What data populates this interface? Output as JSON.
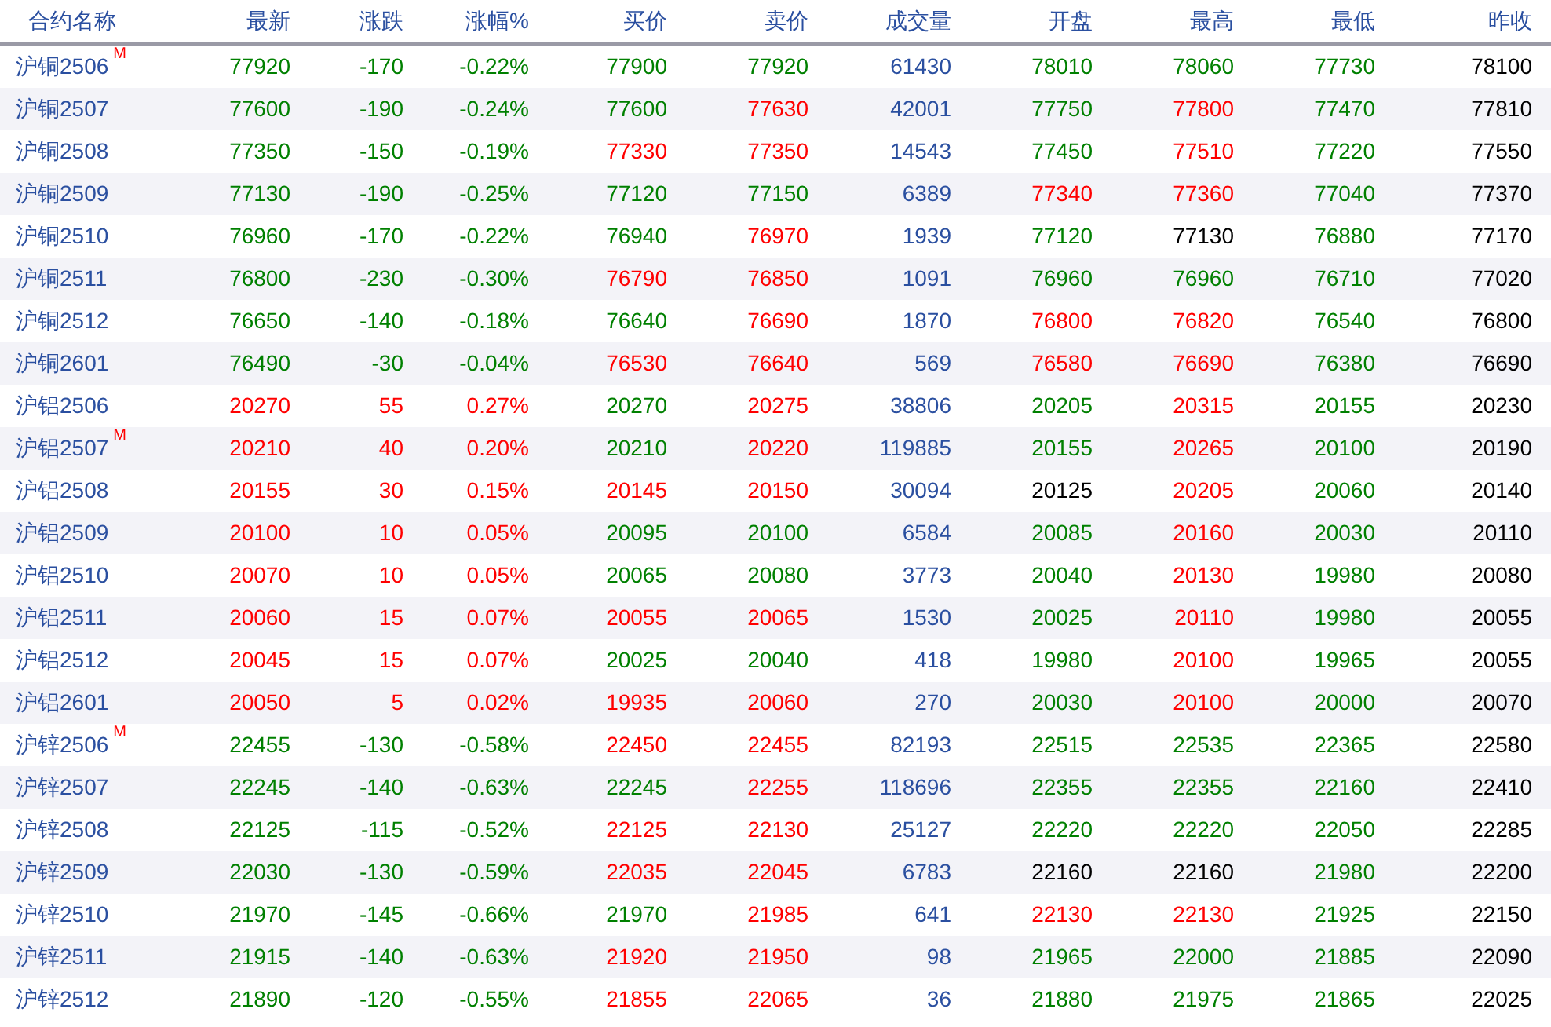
{
  "columns": [
    "合约名称",
    "最新",
    "涨跌",
    "涨幅%",
    "买价",
    "卖价",
    "成交量",
    "开盘",
    "最高",
    "最低",
    "昨收"
  ],
  "rows": [
    {
      "name": "沪铜2506",
      "badge": "M",
      "volume": "61430",
      "cells": [
        {
          "text": "77920",
          "rising": false,
          "falling": true
        },
        {
          "text": "-170",
          "rising": false,
          "falling": true
        },
        {
          "text": "-0.22%",
          "rising": false,
          "falling": true
        },
        {
          "text": "77900",
          "rising": false,
          "falling": true
        },
        {
          "text": "77920",
          "rising": false,
          "falling": true
        },
        {
          "text": "78010",
          "rising": false,
          "falling": true
        },
        {
          "text": "78060",
          "rising": false,
          "falling": true
        },
        {
          "text": "77730",
          "rising": false,
          "falling": true
        },
        {
          "text": "78100",
          "rising": false,
          "falling": false
        }
      ]
    },
    {
      "name": "沪铜2507",
      "volume": "42001",
      "cells": [
        {
          "text": "77600",
          "rising": false,
          "falling": true
        },
        {
          "text": "-190",
          "rising": false,
          "falling": true
        },
        {
          "text": "-0.24%",
          "rising": false,
          "falling": true
        },
        {
          "text": "77600",
          "rising": false,
          "falling": true
        },
        {
          "text": "77630",
          "rising": true,
          "falling": false
        },
        {
          "text": "77750",
          "rising": false,
          "falling": true
        },
        {
          "text": "77800",
          "rising": true,
          "falling": false
        },
        {
          "text": "77470",
          "rising": false,
          "falling": true
        },
        {
          "text": "77810",
          "rising": false,
          "falling": false
        }
      ]
    },
    {
      "name": "沪铜2508",
      "volume": "14543",
      "cells": [
        {
          "text": "77350",
          "rising": false,
          "falling": true
        },
        {
          "text": "-150",
          "rising": false,
          "falling": true
        },
        {
          "text": "-0.19%",
          "rising": false,
          "falling": true
        },
        {
          "text": "77330",
          "rising": true,
          "falling": false
        },
        {
          "text": "77350",
          "rising": true,
          "falling": false
        },
        {
          "text": "77450",
          "rising": false,
          "falling": true
        },
        {
          "text": "77510",
          "rising": true,
          "falling": false
        },
        {
          "text": "77220",
          "rising": false,
          "falling": true
        },
        {
          "text": "77550",
          "rising": false,
          "falling": false
        }
      ]
    },
    {
      "name": "沪铜2509",
      "volume": "6389",
      "cells": [
        {
          "text": "77130",
          "rising": false,
          "falling": true
        },
        {
          "text": "-190",
          "rising": false,
          "falling": true
        },
        {
          "text": "-0.25%",
          "rising": false,
          "falling": true
        },
        {
          "text": "77120",
          "rising": false,
          "falling": true
        },
        {
          "text": "77150",
          "rising": false,
          "falling": true
        },
        {
          "text": "77340",
          "rising": true,
          "falling": false
        },
        {
          "text": "77360",
          "rising": true,
          "falling": false
        },
        {
          "text": "77040",
          "rising": false,
          "falling": true
        },
        {
          "text": "77370",
          "rising": false,
          "falling": false
        }
      ]
    },
    {
      "name": "沪铜2510",
      "volume": "1939",
      "cells": [
        {
          "text": "76960",
          "rising": false,
          "falling": true
        },
        {
          "text": "-170",
          "rising": false,
          "falling": true
        },
        {
          "text": "-0.22%",
          "rising": false,
          "falling": true
        },
        {
          "text": "76940",
          "rising": false,
          "falling": true
        },
        {
          "text": "76970",
          "rising": true,
          "falling": false
        },
        {
          "text": "77120",
          "rising": false,
          "falling": true
        },
        {
          "text": "77130",
          "rising": false,
          "falling": false
        },
        {
          "text": "76880",
          "rising": false,
          "falling": true
        },
        {
          "text": "77170",
          "rising": false,
          "falling": false
        }
      ]
    },
    {
      "name": "沪铜2511",
      "volume": "1091",
      "cells": [
        {
          "text": "76800",
          "rising": false,
          "falling": true
        },
        {
          "text": "-230",
          "rising": false,
          "falling": true
        },
        {
          "text": "-0.30%",
          "rising": false,
          "falling": true
        },
        {
          "text": "76790",
          "rising": true,
          "falling": false
        },
        {
          "text": "76850",
          "rising": true,
          "falling": false
        },
        {
          "text": "76960",
          "rising": false,
          "falling": true
        },
        {
          "text": "76960",
          "rising": false,
          "falling": true
        },
        {
          "text": "76710",
          "rising": false,
          "falling": true
        },
        {
          "text": "77020",
          "rising": false,
          "falling": false
        }
      ]
    },
    {
      "name": "沪铜2512",
      "volume": "1870",
      "cells": [
        {
          "text": "76650",
          "rising": false,
          "falling": true
        },
        {
          "text": "-140",
          "rising": false,
          "falling": true
        },
        {
          "text": "-0.18%",
          "rising": false,
          "falling": true
        },
        {
          "text": "76640",
          "rising": false,
          "falling": true
        },
        {
          "text": "76690",
          "rising": true,
          "falling": false
        },
        {
          "text": "76800",
          "rising": true,
          "falling": false
        },
        {
          "text": "76820",
          "rising": true,
          "falling": false
        },
        {
          "text": "76540",
          "rising": false,
          "falling": true
        },
        {
          "text": "76800",
          "rising": false,
          "falling": false
        }
      ]
    },
    {
      "name": "沪铜2601",
      "volume": "569",
      "cells": [
        {
          "text": "76490",
          "rising": false,
          "falling": true
        },
        {
          "text": "-30",
          "rising": false,
          "falling": true
        },
        {
          "text": "-0.04%",
          "rising": false,
          "falling": true
        },
        {
          "text": "76530",
          "rising": true,
          "falling": false
        },
        {
          "text": "76640",
          "rising": true,
          "falling": false
        },
        {
          "text": "76580",
          "rising": true,
          "falling": false
        },
        {
          "text": "76690",
          "rising": true,
          "falling": false
        },
        {
          "text": "76380",
          "rising": false,
          "falling": true
        },
        {
          "text": "76690",
          "rising": false,
          "falling": false
        }
      ]
    },
    {
      "name": "沪铝2506",
      "volume": "38806",
      "cells": [
        {
          "text": "20270",
          "rising": true,
          "falling": false
        },
        {
          "text": "55",
          "rising": true,
          "falling": false
        },
        {
          "text": "0.27%",
          "rising": true,
          "falling": false
        },
        {
          "text": "20270",
          "rising": false,
          "falling": true
        },
        {
          "text": "20275",
          "rising": true,
          "falling": false
        },
        {
          "text": "20205",
          "rising": false,
          "falling": true
        },
        {
          "text": "20315",
          "rising": true,
          "falling": false
        },
        {
          "text": "20155",
          "rising": false,
          "falling": true
        },
        {
          "text": "20230",
          "rising": false,
          "falling": false
        }
      ]
    },
    {
      "name": "沪铝2507",
      "badge": "M",
      "volume": "119885",
      "cells": [
        {
          "text": "20210",
          "rising": true,
          "falling": false
        },
        {
          "text": "40",
          "rising": true,
          "falling": false
        },
        {
          "text": "0.20%",
          "rising": true,
          "falling": false
        },
        {
          "text": "20210",
          "rising": false,
          "falling": true
        },
        {
          "text": "20220",
          "rising": true,
          "falling": false
        },
        {
          "text": "20155",
          "rising": false,
          "falling": true
        },
        {
          "text": "20265",
          "rising": true,
          "falling": false
        },
        {
          "text": "20100",
          "rising": false,
          "falling": true
        },
        {
          "text": "20190",
          "rising": false,
          "falling": false
        }
      ]
    },
    {
      "name": "沪铝2508",
      "volume": "30094",
      "cells": [
        {
          "text": "20155",
          "rising": true,
          "falling": false
        },
        {
          "text": "30",
          "rising": true,
          "falling": false
        },
        {
          "text": "0.15%",
          "rising": true,
          "falling": false
        },
        {
          "text": "20145",
          "rising": true,
          "falling": false
        },
        {
          "text": "20150",
          "rising": true,
          "falling": false
        },
        {
          "text": "20125",
          "rising": false,
          "falling": false
        },
        {
          "text": "20205",
          "rising": true,
          "falling": false
        },
        {
          "text": "20060",
          "rising": false,
          "falling": true
        },
        {
          "text": "20140",
          "rising": false,
          "falling": false
        }
      ]
    },
    {
      "name": "沪铝2509",
      "volume": "6584",
      "cells": [
        {
          "text": "20100",
          "rising": true,
          "falling": false
        },
        {
          "text": "10",
          "rising": true,
          "falling": false
        },
        {
          "text": "0.05%",
          "rising": true,
          "falling": false
        },
        {
          "text": "20095",
          "rising": false,
          "falling": true
        },
        {
          "text": "20100",
          "rising": false,
          "falling": true
        },
        {
          "text": "20085",
          "rising": false,
          "falling": true
        },
        {
          "text": "20160",
          "rising": true,
          "falling": false
        },
        {
          "text": "20030",
          "rising": false,
          "falling": true
        },
        {
          "text": "20110",
          "rising": false,
          "falling": false
        }
      ]
    },
    {
      "name": "沪铝2510",
      "volume": "3773",
      "cells": [
        {
          "text": "20070",
          "rising": true,
          "falling": false
        },
        {
          "text": "10",
          "rising": true,
          "falling": false
        },
        {
          "text": "0.05%",
          "rising": true,
          "falling": false
        },
        {
          "text": "20065",
          "rising": false,
          "falling": true
        },
        {
          "text": "20080",
          "rising": false,
          "falling": true
        },
        {
          "text": "20040",
          "rising": false,
          "falling": true
        },
        {
          "text": "20130",
          "rising": true,
          "falling": false
        },
        {
          "text": "19980",
          "rising": false,
          "falling": true
        },
        {
          "text": "20080",
          "rising": false,
          "falling": false
        }
      ]
    },
    {
      "name": "沪铝2511",
      "volume": "1530",
      "cells": [
        {
          "text": "20060",
          "rising": true,
          "falling": false
        },
        {
          "text": "15",
          "rising": true,
          "falling": false
        },
        {
          "text": "0.07%",
          "rising": true,
          "falling": false
        },
        {
          "text": "20055",
          "rising": true,
          "falling": false
        },
        {
          "text": "20065",
          "rising": true,
          "falling": false
        },
        {
          "text": "20025",
          "rising": false,
          "falling": true
        },
        {
          "text": "20110",
          "rising": true,
          "falling": false
        },
        {
          "text": "19980",
          "rising": false,
          "falling": true
        },
        {
          "text": "20055",
          "rising": false,
          "falling": false
        }
      ]
    },
    {
      "name": "沪铝2512",
      "volume": "418",
      "cells": [
        {
          "text": "20045",
          "rising": true,
          "falling": false
        },
        {
          "text": "15",
          "rising": true,
          "falling": false
        },
        {
          "text": "0.07%",
          "rising": true,
          "falling": false
        },
        {
          "text": "20025",
          "rising": false,
          "falling": true
        },
        {
          "text": "20040",
          "rising": false,
          "falling": true
        },
        {
          "text": "19980",
          "rising": false,
          "falling": true
        },
        {
          "text": "20100",
          "rising": true,
          "falling": false
        },
        {
          "text": "19965",
          "rising": false,
          "falling": true
        },
        {
          "text": "20055",
          "rising": false,
          "falling": false
        }
      ]
    },
    {
      "name": "沪铝2601",
      "volume": "270",
      "cells": [
        {
          "text": "20050",
          "rising": true,
          "falling": false
        },
        {
          "text": "5",
          "rising": true,
          "falling": false
        },
        {
          "text": "0.02%",
          "rising": true,
          "falling": false
        },
        {
          "text": "19935",
          "rising": true,
          "falling": false
        },
        {
          "text": "20060",
          "rising": true,
          "falling": false
        },
        {
          "text": "20030",
          "rising": false,
          "falling": true
        },
        {
          "text": "20100",
          "rising": true,
          "falling": false
        },
        {
          "text": "20000",
          "rising": false,
          "falling": true
        },
        {
          "text": "20070",
          "rising": false,
          "falling": false
        }
      ]
    },
    {
      "name": "沪锌2506",
      "badge": "M",
      "volume": "82193",
      "cells": [
        {
          "text": "22455",
          "rising": false,
          "falling": true
        },
        {
          "text": "-130",
          "rising": false,
          "falling": true
        },
        {
          "text": "-0.58%",
          "rising": false,
          "falling": true
        },
        {
          "text": "22450",
          "rising": true,
          "falling": false
        },
        {
          "text": "22455",
          "rising": true,
          "falling": false
        },
        {
          "text": "22515",
          "rising": false,
          "falling": true
        },
        {
          "text": "22535",
          "rising": false,
          "falling": true
        },
        {
          "text": "22365",
          "rising": false,
          "falling": true
        },
        {
          "text": "22580",
          "rising": false,
          "falling": false
        }
      ]
    },
    {
      "name": "沪锌2507",
      "volume": "118696",
      "cells": [
        {
          "text": "22245",
          "rising": false,
          "falling": true
        },
        {
          "text": "-140",
          "rising": false,
          "falling": true
        },
        {
          "text": "-0.63%",
          "rising": false,
          "falling": true
        },
        {
          "text": "22245",
          "rising": false,
          "falling": true
        },
        {
          "text": "22255",
          "rising": true,
          "falling": false
        },
        {
          "text": "22355",
          "rising": false,
          "falling": true
        },
        {
          "text": "22355",
          "rising": false,
          "falling": true
        },
        {
          "text": "22160",
          "rising": false,
          "falling": true
        },
        {
          "text": "22410",
          "rising": false,
          "falling": false
        }
      ]
    },
    {
      "name": "沪锌2508",
      "volume": "25127",
      "cells": [
        {
          "text": "22125",
          "rising": false,
          "falling": true
        },
        {
          "text": "-115",
          "rising": false,
          "falling": true
        },
        {
          "text": "-0.52%",
          "rising": false,
          "falling": true
        },
        {
          "text": "22125",
          "rising": true,
          "falling": false
        },
        {
          "text": "22130",
          "rising": true,
          "falling": false
        },
        {
          "text": "22220",
          "rising": false,
          "falling": true
        },
        {
          "text": "22220",
          "rising": false,
          "falling": true
        },
        {
          "text": "22050",
          "rising": false,
          "falling": true
        },
        {
          "text": "22285",
          "rising": false,
          "falling": false
        }
      ]
    },
    {
      "name": "沪锌2509",
      "volume": "6783",
      "cells": [
        {
          "text": "22030",
          "rising": false,
          "falling": true
        },
        {
          "text": "-130",
          "rising": false,
          "falling": true
        },
        {
          "text": "-0.59%",
          "rising": false,
          "falling": true
        },
        {
          "text": "22035",
          "rising": true,
          "falling": false
        },
        {
          "text": "22045",
          "rising": true,
          "falling": false
        },
        {
          "text": "22160",
          "rising": false,
          "falling": false
        },
        {
          "text": "22160",
          "rising": false,
          "falling": false
        },
        {
          "text": "21980",
          "rising": false,
          "falling": true
        },
        {
          "text": "22200",
          "rising": false,
          "falling": false
        }
      ]
    },
    {
      "name": "沪锌2510",
      "volume": "641",
      "cells": [
        {
          "text": "21970",
          "rising": false,
          "falling": true
        },
        {
          "text": "-145",
          "rising": false,
          "falling": true
        },
        {
          "text": "-0.66%",
          "rising": false,
          "falling": true
        },
        {
          "text": "21970",
          "rising": false,
          "falling": true
        },
        {
          "text": "21985",
          "rising": true,
          "falling": false
        },
        {
          "text": "22130",
          "rising": true,
          "falling": false
        },
        {
          "text": "22130",
          "rising": true,
          "falling": false
        },
        {
          "text": "21925",
          "rising": false,
          "falling": true
        },
        {
          "text": "22150",
          "rising": false,
          "falling": false
        }
      ]
    },
    {
      "name": "沪锌2511",
      "volume": "98",
      "cells": [
        {
          "text": "21915",
          "rising": false,
          "falling": true
        },
        {
          "text": "-140",
          "rising": false,
          "falling": true
        },
        {
          "text": "-0.63%",
          "rising": false,
          "falling": true
        },
        {
          "text": "21920",
          "rising": true,
          "falling": false
        },
        {
          "text": "21950",
          "rising": true,
          "falling": false
        },
        {
          "text": "21965",
          "rising": false,
          "falling": true
        },
        {
          "text": "22000",
          "rising": false,
          "falling": true
        },
        {
          "text": "21885",
          "rising": false,
          "falling": true
        },
        {
          "text": "22090",
          "rising": false,
          "falling": false
        }
      ]
    },
    {
      "name": "沪锌2512",
      "volume": "36",
      "cells": [
        {
          "text": "21890",
          "rising": false,
          "falling": true
        },
        {
          "text": "-120",
          "rising": false,
          "falling": true
        },
        {
          "text": "-0.55%",
          "rising": false,
          "falling": true
        },
        {
          "text": "21855",
          "rising": true,
          "falling": false
        },
        {
          "text": "22065",
          "rising": true,
          "falling": false
        },
        {
          "text": "21880",
          "rising": false,
          "falling": true
        },
        {
          "text": "21975",
          "rising": false,
          "falling": true
        },
        {
          "text": "21865",
          "rising": false,
          "falling": true
        },
        {
          "text": "22025",
          "rising": false,
          "falling": false
        }
      ]
    }
  ]
}
